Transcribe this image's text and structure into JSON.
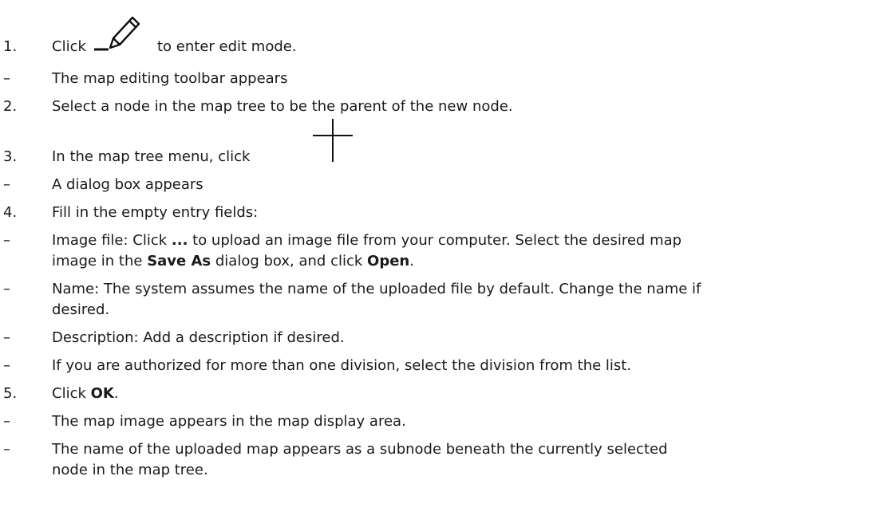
{
  "steps": [
    {
      "marker": "1.",
      "parts": [
        {
          "t": "Click "
        },
        {
          "icon": "edit-pencil-icon"
        },
        {
          "t": " to enter edit mode."
        }
      ]
    },
    {
      "marker": "–",
      "parts": [
        {
          "t": "The map editing toolbar appears"
        }
      ]
    },
    {
      "marker": "2.",
      "parts": [
        {
          "t": "Select a node in the map tree to be the parent of the new node."
        }
      ]
    },
    {
      "marker": "3.",
      "parts": [
        {
          "t": "In the map tree menu, click "
        },
        {
          "icon": "add-node-plus-icon"
        }
      ]
    },
    {
      "marker": "–",
      "parts": [
        {
          "t": "A dialog box appears"
        }
      ]
    },
    {
      "marker": "4.",
      "parts": [
        {
          "t": "Fill in the empty entry fields:"
        }
      ]
    },
    {
      "marker": "–",
      "parts": [
        {
          "t": "Image file: Click "
        },
        {
          "b": "..."
        },
        {
          "t": " to upload an image file from your computer. Select the desired map"
        }
      ]
    },
    {
      "marker": "",
      "parts": [
        {
          "t": "image in the "
        },
        {
          "b": "Save As"
        },
        {
          "t": " dialog box, and click "
        },
        {
          "b": "Open"
        },
        {
          "t": "."
        }
      ]
    },
    {
      "marker": "–",
      "parts": [
        {
          "t": "Name: The system assumes the name of the uploaded file by default. Change the name if"
        }
      ]
    },
    {
      "marker": "",
      "parts": [
        {
          "t": "desired."
        }
      ]
    },
    {
      "marker": "–",
      "parts": [
        {
          "t": "Description: Add a description if desired."
        }
      ]
    },
    {
      "marker": "–",
      "parts": [
        {
          "t": "If you are authorized for more than one division, select the division from the list."
        }
      ]
    },
    {
      "marker": "5.",
      "parts": [
        {
          "t": "Click "
        },
        {
          "b": "OK"
        },
        {
          "t": "."
        }
      ]
    },
    {
      "marker": "–",
      "parts": [
        {
          "t": "The map image appears in the map display area."
        }
      ]
    },
    {
      "marker": "–",
      "parts": [
        {
          "t": "The name of the uploaded map appears as a subnode beneath the currently selected"
        }
      ]
    },
    {
      "marker": "",
      "parts": [
        {
          "t": "node in the map tree."
        }
      ]
    }
  ]
}
